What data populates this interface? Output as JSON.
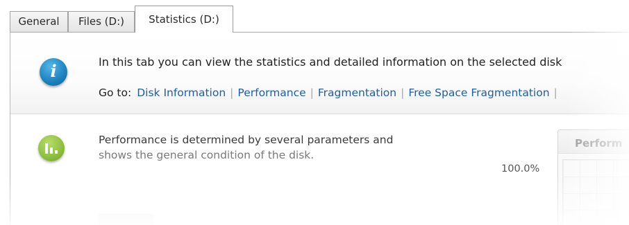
{
  "tabs": [
    {
      "label": "General"
    },
    {
      "label": "Files (D:)"
    },
    {
      "label": "Statistics (D:)",
      "active": true
    }
  ],
  "info": {
    "icon": "info-icon",
    "text": "In this tab you can view the statistics and detailed information on the selected disk",
    "goto_label": "Go to:",
    "links": [
      "Disk Information",
      "Performance",
      "Fragmentation",
      "Free Space Fragmentation"
    ]
  },
  "performance": {
    "icon": "performance-chart-icon",
    "line1": "Performance is determined by several parameters and",
    "line2": "shows the general condition of the disk.",
    "value": "100.0%",
    "chart_header": "Perform"
  },
  "colors": {
    "link": "#1a5db6",
    "info_icon": "#1f86c3",
    "performance_icon": "#8dbf3d"
  }
}
